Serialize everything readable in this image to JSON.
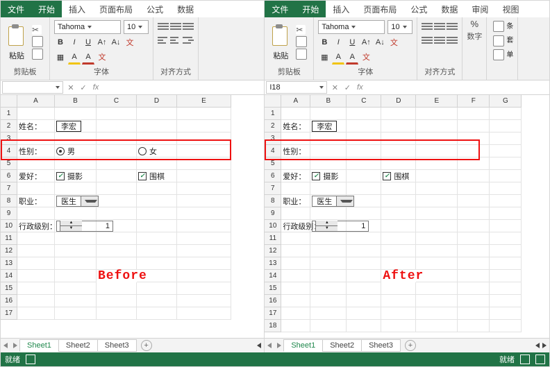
{
  "tabs": {
    "file": "文件",
    "home": "开始",
    "insert": "插入",
    "layout": "页面布局",
    "formulas": "公式",
    "data": "数据",
    "review": "审阅",
    "view": "视图"
  },
  "ribbon": {
    "font_name": "Tahoma",
    "font_size": "10",
    "grp_clipboard": "剪贴板",
    "grp_font": "字体",
    "grp_align": "对齐方式",
    "grp_number": "数字",
    "paste_label": "粘贴",
    "btn_bold": "B",
    "btn_italic": "I",
    "btn_underline": "U",
    "side": {
      "cond": "条",
      "set": "套",
      "cell": "单"
    }
  },
  "namebox_left": "",
  "namebox_right": "I18",
  "fx_label": "fx",
  "cols_left": [
    "A",
    "B",
    "C",
    "D",
    "E"
  ],
  "cols_right": [
    "A",
    "B",
    "C",
    "D",
    "E",
    "F",
    "G"
  ],
  "rows_left": [
    "1",
    "2",
    "3",
    "4",
    "5",
    "6",
    "7",
    "8",
    "9",
    "10",
    "11",
    "12",
    "13",
    "14",
    "15",
    "16",
    "17"
  ],
  "rows_right": [
    "1",
    "2",
    "3",
    "4",
    "5",
    "6",
    "7",
    "8",
    "9",
    "10",
    "11",
    "12",
    "13",
    "14",
    "15",
    "16",
    "17",
    "18"
  ],
  "form": {
    "name_label": "姓名：",
    "name_value": "李宏",
    "gender_label": "性别：",
    "gender_male": "男",
    "gender_female": "女",
    "hobby_label": "爱好：",
    "hobby_photo": "摄影",
    "hobby_go": "围棋",
    "job_label": "职业：",
    "job_value": "医生",
    "rank_label": "行政级别：",
    "rank_value": "1"
  },
  "big_before": "Before",
  "big_after": "After",
  "sheets": {
    "s1": "Sheet1",
    "s2": "Sheet2",
    "s3": "Sheet3"
  },
  "status": {
    "ready": "就绪"
  }
}
